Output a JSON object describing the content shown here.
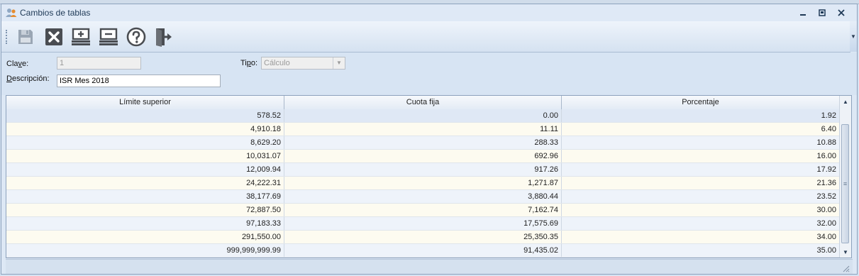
{
  "window": {
    "title": "Cambios de tablas",
    "title_icon": "users-icon",
    "minimize_glyph": "▁",
    "maximize_glyph": "▣",
    "close_glyph": "✕"
  },
  "toolbar": {
    "buttons": [
      {
        "name": "save-button",
        "icon": "floppy-disk-icon",
        "enabled": false
      },
      {
        "name": "cancel-button",
        "icon": "close-x-icon",
        "enabled": true
      },
      {
        "name": "add-row-button",
        "icon": "add-row-icon",
        "enabled": true
      },
      {
        "name": "remove-row-button",
        "icon": "remove-row-icon",
        "enabled": true
      },
      {
        "name": "help-button",
        "icon": "question-circle-icon",
        "enabled": true
      },
      {
        "name": "exit-button",
        "icon": "exit-door-icon",
        "enabled": true
      }
    ],
    "overflow_glyph": "▼"
  },
  "form": {
    "clave_label_pre": "Cla",
    "clave_label_ul": "v",
    "clave_label_post": "e:",
    "clave_value": "1",
    "tipo_label_pre": "Ti",
    "tipo_label_ul": "p",
    "tipo_label_post": "o:",
    "tipo_value": "Cálculo",
    "descripcion_label_ul": "D",
    "descripcion_label_post": "escripción:",
    "descripcion_value": "ISR Mes 2018"
  },
  "table": {
    "columns": [
      "Límite superior",
      "Cuota fija",
      "Porcentaje"
    ],
    "rows": [
      [
        "578.52",
        "0.00",
        "1.92"
      ],
      [
        "4,910.18",
        "11.11",
        "6.40"
      ],
      [
        "8,629.20",
        "288.33",
        "10.88"
      ],
      [
        "10,031.07",
        "692.96",
        "16.00"
      ],
      [
        "12,009.94",
        "917.26",
        "17.92"
      ],
      [
        "24,222.31",
        "1,271.87",
        "21.36"
      ],
      [
        "38,177.69",
        "3,880.44",
        "23.52"
      ],
      [
        "72,887.50",
        "7,162.74",
        "30.00"
      ],
      [
        "97,183.33",
        "17,575.69",
        "32.00"
      ],
      [
        "291,550.00",
        "25,350.35",
        "34.00"
      ],
      [
        "999,999,999.99",
        "91,435.02",
        "35.00"
      ]
    ],
    "selected_row": 0
  },
  "scrollbar": {
    "up_glyph": "▲",
    "down_glyph": "▼",
    "thumb_glyph": "≡"
  },
  "colors": {
    "window_bg": "#dde8f5",
    "row_odd": "#fdfbf0",
    "row_even": "#eef3fa",
    "accent": "#1e3956"
  }
}
